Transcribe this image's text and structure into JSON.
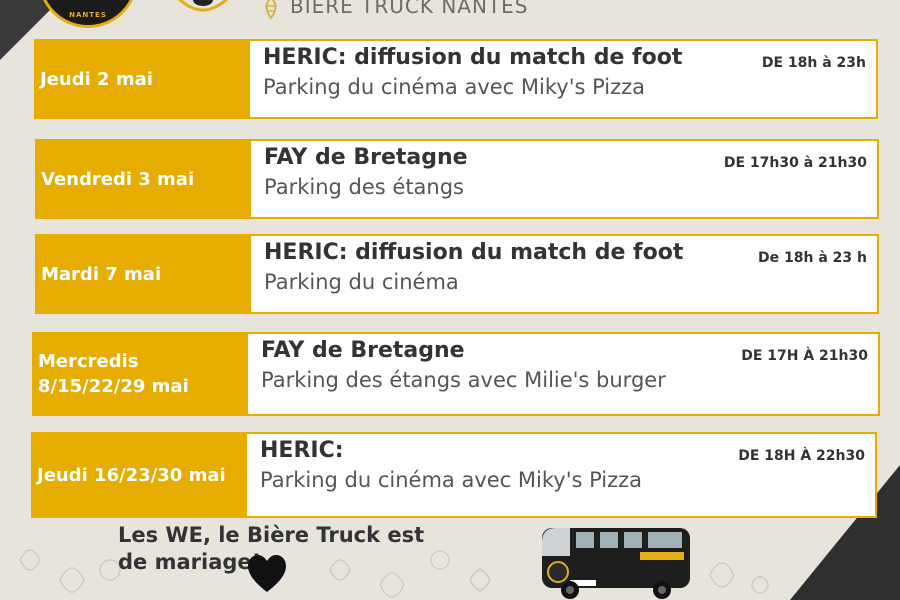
{
  "header": {
    "logo_text": "NANTES",
    "brand": "BIÈRE TRUCK NANTES"
  },
  "events": [
    {
      "date": "Jeudi 2 mai",
      "place": "HERIC: diffusion du match de foot",
      "detail": "Parking du cinéma avec Miky's Pizza",
      "time": "DE 18h à 23h"
    },
    {
      "date": "Vendredi 3 mai",
      "place": "FAY de Bretagne",
      "detail": "Parking des étangs",
      "time": "DE 17h30 à 21h30"
    },
    {
      "date": "Mardi 7 mai",
      "place": "HERIC: diffusion du match de foot",
      "detail": "Parking du cinéma",
      "time": "De 18h à 23 h"
    },
    {
      "date": "Mercredis 8/15/22/29 mai",
      "place": "FAY de Bretagne",
      "detail": "Parking des étangs avec Milie's burger",
      "time": "DE 17H À 21h30"
    },
    {
      "date": "Jeudi 16/23/30 mai",
      "place": "HERIC:",
      "detail": "Parking du cinéma avec Miky's Pizza",
      "time": "DE 18H À 22h30"
    }
  ],
  "footer": {
    "message": "Les WE, le Bière Truck est de mariage!",
    "heart_icon": "heart-icon",
    "van_image": "food-truck-van-image"
  },
  "colors": {
    "accent": "#e6ad00",
    "background": "#e7e4dc",
    "dark": "#2f2f2f",
    "text": "#333333"
  }
}
